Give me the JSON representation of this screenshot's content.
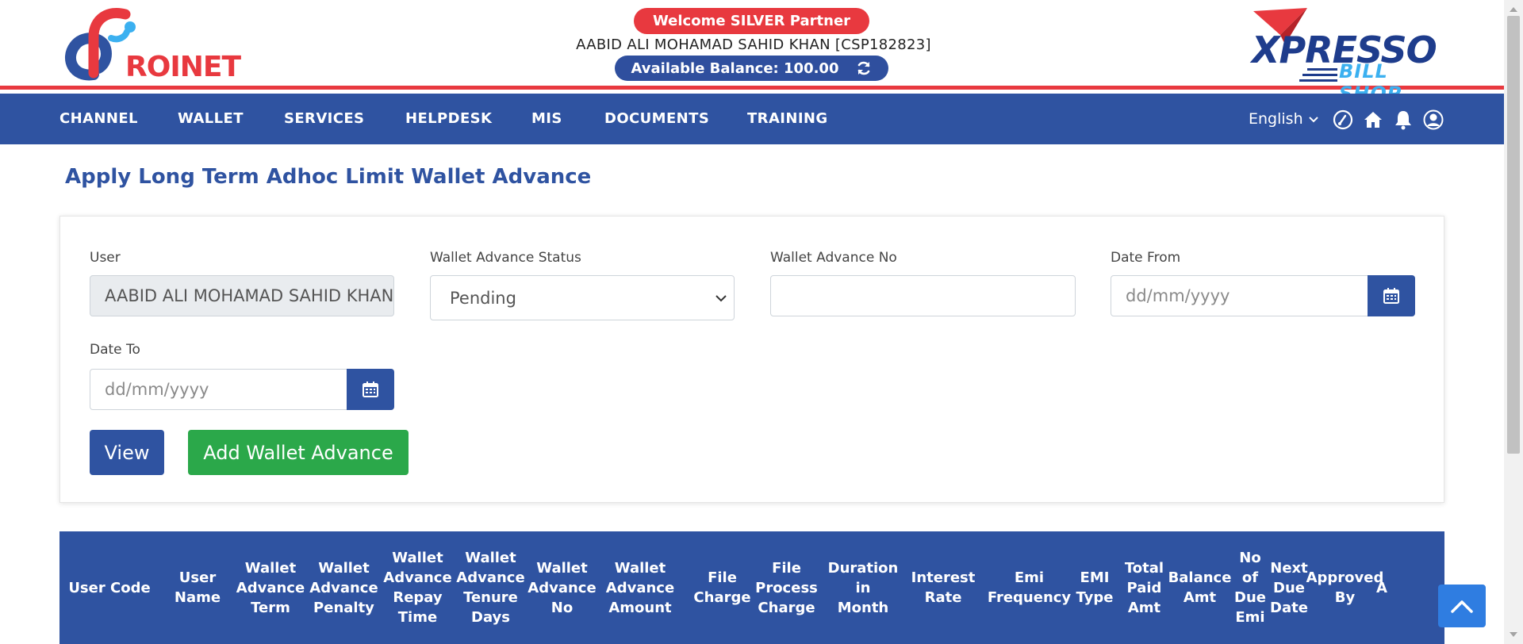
{
  "header": {
    "logo_left_text": "ROINET",
    "welcome": "Welcome SILVER Partner",
    "user_line": "AABID ALI MOHAMAD SAHID KHAN [CSP182823]",
    "balance": "Available Balance: 100.00",
    "logo_right_top": "XPRESSO",
    "logo_right_bottom": "BILL SHOP"
  },
  "nav": {
    "items": [
      "CHANNEL",
      "WALLET",
      "SERVICES",
      "HELPDESK",
      "MIS",
      "DOCUMENTS",
      "TRAINING"
    ],
    "language": "English"
  },
  "page": {
    "title": "Apply Long Term Adhoc Limit Wallet Advance"
  },
  "form": {
    "user": {
      "label": "User",
      "value": "AABID ALI MOHAMAD  SAHID KHAN"
    },
    "status": {
      "label": "Wallet Advance Status",
      "value": "Pending"
    },
    "advance_no": {
      "label": "Wallet Advance No",
      "value": ""
    },
    "date_from": {
      "label": "Date From",
      "placeholder": "dd/mm/yyyy"
    },
    "date_to": {
      "label": "Date To",
      "placeholder": "dd/mm/yyyy"
    },
    "view_label": "View",
    "add_label": "Add Wallet Advance"
  },
  "table": {
    "headers": [
      [
        "User Code"
      ],
      [
        "User",
        "Name"
      ],
      [
        "Wallet",
        "Advance",
        "Term"
      ],
      [
        "Wallet",
        "Advance",
        "Penalty"
      ],
      [
        "Wallet",
        "Advance",
        "Repay",
        "Time"
      ],
      [
        "Wallet",
        "Advance",
        "Tenure",
        "Days"
      ],
      [
        "Wallet",
        "Advance",
        "No"
      ],
      [
        "Wallet",
        "Advance",
        "Amount"
      ],
      [
        "File",
        "Charge"
      ],
      [
        "File",
        "Process",
        "Charge"
      ],
      [
        "Duration",
        "in",
        "Month"
      ],
      [
        "Interest",
        "Rate"
      ],
      [
        "Emi",
        "Frequency"
      ],
      [
        "EMI",
        "Type"
      ],
      [
        "Total",
        "Paid",
        "Amt"
      ],
      [
        "Balance",
        "Amt"
      ],
      [
        "No",
        "of",
        "Due",
        "Emi"
      ],
      [
        "Next",
        "Due",
        "Date"
      ],
      [
        "Approved",
        "By"
      ],
      [
        "A"
      ]
    ]
  },
  "colors": {
    "primary": "#2f53a1",
    "danger": "#e8393f",
    "success": "#2ba84a",
    "scroll_top": "#2f7de1"
  }
}
